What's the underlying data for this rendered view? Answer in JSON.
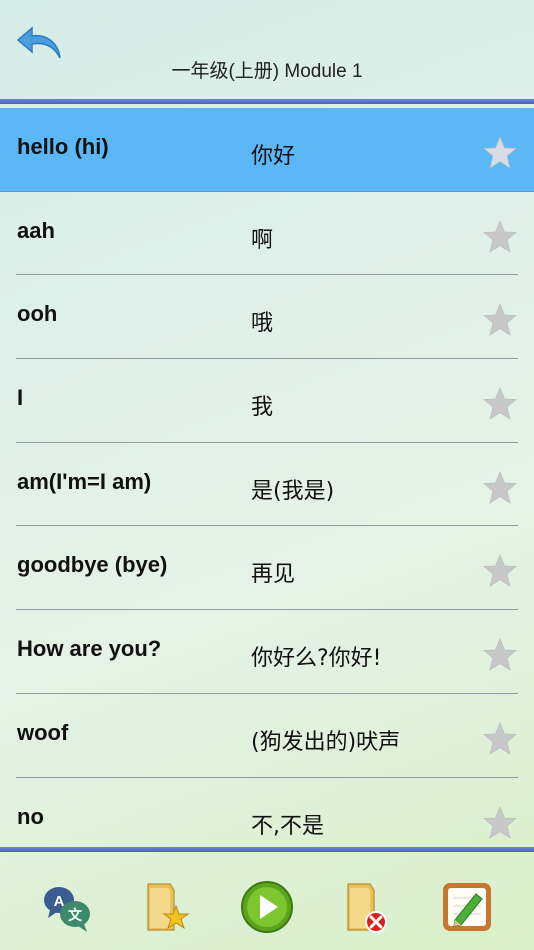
{
  "header": {
    "title": "一年级(上册)  Module 1",
    "back_icon": "back-arrow-icon"
  },
  "colors": {
    "selected_row": "#5cb7f7",
    "rule": "#4b63c4",
    "star_inactive": "#c8c8c8"
  },
  "words": [
    {
      "en": "hello (hi)",
      "zh": "你好",
      "selected": true,
      "starred": false
    },
    {
      "en": "aah",
      "zh": "啊",
      "selected": false,
      "starred": false
    },
    {
      "en": "ooh",
      "zh": "哦",
      "selected": false,
      "starred": false
    },
    {
      "en": "I",
      "zh": "我",
      "selected": false,
      "starred": false
    },
    {
      "en": "am(I'm=I am)",
      "zh": "是(我是)",
      "selected": false,
      "starred": false
    },
    {
      "en": "goodbye (bye)",
      "zh": "再见",
      "selected": false,
      "starred": false
    },
    {
      "en": "How are you?",
      "zh": "你好么?你好!",
      "selected": false,
      "starred": false
    },
    {
      "en": "woof",
      "zh": "(狗发出的)吠声",
      "selected": false,
      "starred": false
    },
    {
      "en": "no",
      "zh": "不,不是",
      "selected": false,
      "starred": false
    }
  ],
  "toolbar": {
    "items": [
      {
        "name": "translate-icon"
      },
      {
        "name": "favorites-folder-icon"
      },
      {
        "name": "play-icon"
      },
      {
        "name": "delete-folder-icon"
      },
      {
        "name": "edit-note-icon"
      }
    ]
  }
}
